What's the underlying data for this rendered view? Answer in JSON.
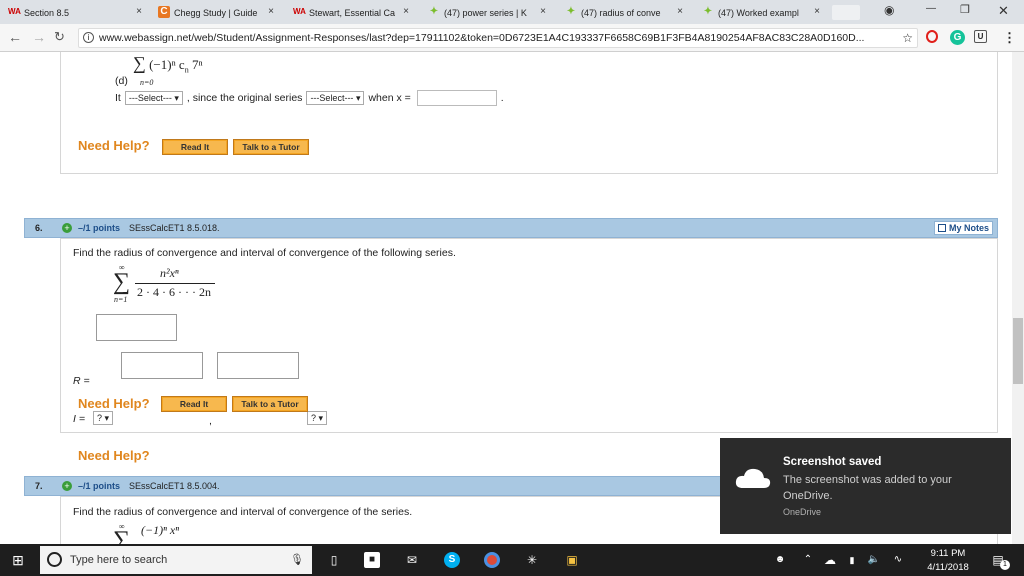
{
  "tabs": [
    {
      "label": "Section 8.5",
      "icon": "WA"
    },
    {
      "label": "Chegg Study | Guide",
      "icon": "C"
    },
    {
      "label": "Stewart, Essential Ca",
      "icon": "WA"
    },
    {
      "label": "(47) power series | K",
      "icon": "leaf"
    },
    {
      "label": "(47) radius of conve",
      "icon": "leaf"
    },
    {
      "label": "(47) Worked exampl",
      "icon": "leaf"
    }
  ],
  "tab_close": "×",
  "window": {
    "minimize": "—",
    "restore": "❐",
    "close": "✕"
  },
  "address": {
    "url": "www.webassign.net/web/Student/Assignment-Responses/last?dep=17911102&token=0D6723E1A4C193337F6658C69B1F3FB4A8190254AF8AC83C28A0D160D...",
    "star": "☆"
  },
  "prev_question": {
    "series_text": "∑(−1)ⁿ cₙ 7ⁿ",
    "part": "(d)",
    "n_lower": "n=0",
    "it": "It",
    "select1": "---Select---",
    "since": ", since the original series",
    "select2": "---Select---",
    "when": "when x =",
    "period": "."
  },
  "help": {
    "need": "Need Help?",
    "read": "Read It",
    "talk": "Talk to a Tutor"
  },
  "q6": {
    "num": "6.",
    "points": "–/1 points",
    "code": "SEssCalcET1 8.5.018.",
    "notes": "My Notes",
    "text": "Find the radius of convergence and interval of convergence of the following series.",
    "sum_top": "∞",
    "sum_bottom": "n=1",
    "numerator": "n²xⁿ",
    "denominator": "2 · 4 · 6 · · · 2n",
    "r_label": "R =",
    "i_label": "I =",
    "sel_q": "? ▾",
    "comma": ","
  },
  "q7": {
    "num": "7.",
    "points": "–/1 points",
    "code": "SEssCalcET1 8.5.004.",
    "text": "Find the radius of convergence and interval of convergence of the series.",
    "sum_top": "∞",
    "numerator": "(−1)ⁿ xⁿ"
  },
  "toast": {
    "title": "Screenshot saved",
    "body": "The screenshot was added to your OneDrive.",
    "source": "OneDrive"
  },
  "taskbar": {
    "search": "Type here to search",
    "time": "9:11 PM",
    "date": "4/11/2018",
    "notif": "1"
  }
}
